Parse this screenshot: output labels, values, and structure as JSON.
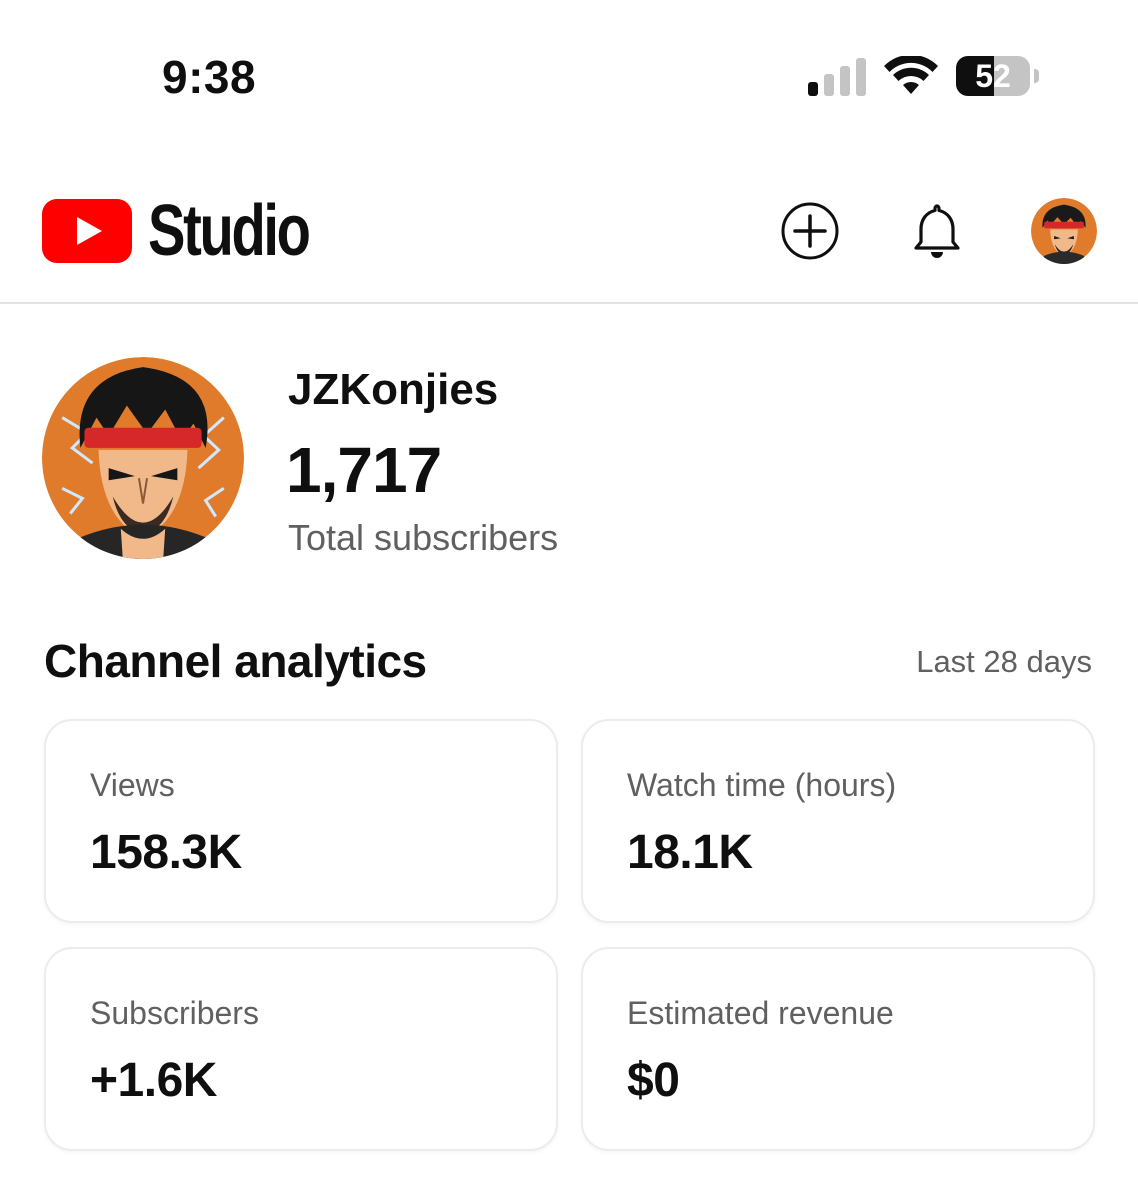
{
  "status_bar": {
    "time": "9:38",
    "battery_level": "52",
    "battery_fraction": 0.52,
    "signal_bars_active": 1,
    "signal_bars_total": 4
  },
  "header": {
    "logo_text": "Studio",
    "brand_color": "#ff0000",
    "create_icon": "plus-circle-icon",
    "notifications_icon": "bell-icon"
  },
  "channel": {
    "name": "JZKonjies",
    "subscriber_count": "1,717",
    "subscriber_label": "Total subscribers"
  },
  "analytics": {
    "title": "Channel analytics",
    "period": "Last 28 days",
    "cards": [
      {
        "label": "Views",
        "value": "158.3K"
      },
      {
        "label": "Watch time (hours)",
        "value": "18.1K"
      },
      {
        "label": "Subscribers",
        "value": "+1.6K"
      },
      {
        "label": "Estimated revenue",
        "value": "$0"
      }
    ]
  }
}
